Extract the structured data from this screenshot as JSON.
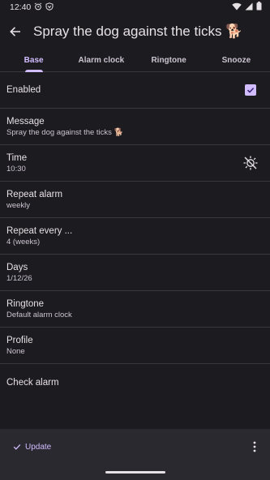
{
  "status_bar": {
    "time": "12:40",
    "icons": [
      "alarm-icon",
      "vpn-icon",
      "wifi-icon",
      "signal-icon",
      "battery-icon"
    ]
  },
  "app_bar": {
    "title": "Spray the dog against the ticks 🐕"
  },
  "tabs": [
    {
      "label": "Base",
      "active": true
    },
    {
      "label": "Alarm clock",
      "active": false
    },
    {
      "label": "Ringtone",
      "active": false
    },
    {
      "label": "Snooze",
      "active": false
    }
  ],
  "settings": [
    {
      "title": "Enabled",
      "value": "",
      "checked": true
    },
    {
      "title": "Message",
      "value": "Spray the dog against the ticks 🐕"
    },
    {
      "title": "Time",
      "value": "10:30",
      "icon": "brightness-auto-icon"
    },
    {
      "title": "Repeat alarm",
      "value": "weekly"
    },
    {
      "title": "Repeat every ...",
      "value": "4 (weeks)"
    },
    {
      "title": "Days",
      "value": "1/12/26"
    },
    {
      "title": "Ringtone",
      "value": "Default alarm clock"
    },
    {
      "title": "Profile",
      "value": "None"
    },
    {
      "title": "Check alarm",
      "value": ""
    }
  ],
  "bottom_bar": {
    "update_label": "Update"
  },
  "colors": {
    "background": "#1c1b1f",
    "accent": "#d0bcff",
    "bottom_bar": "#2b2930",
    "divider": "#3a383e"
  }
}
